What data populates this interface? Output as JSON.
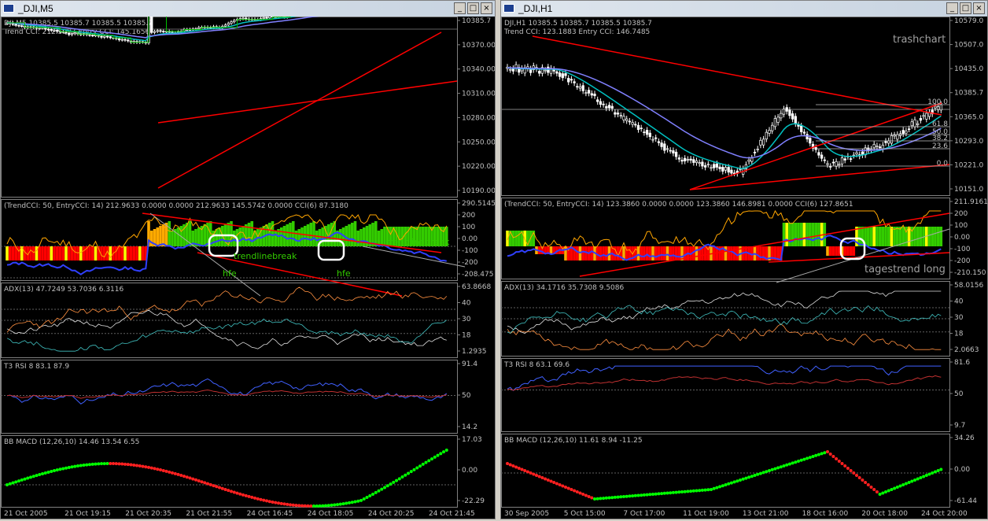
{
  "left_window": {
    "title": "_DJI,M5",
    "main_header_1": "DJI,M5  10385.5  10385.7  10385.5  10385.7",
    "main_header_2": "Trend CCI: 212.5097 Entry CCI: 145.1656",
    "price_ticks": [
      "10385.7",
      "10370.00",
      "10340.00",
      "10310.00",
      "10280.00",
      "10250.00",
      "10220.00",
      "10190.00"
    ],
    "cci_header": "(TrendCCI: 50, EntryCCI: 14)  212.9633  0.0000  0.0000  212.9633  145.5742  0.0000  CCI(6) 87.3180",
    "cci_ticks": [
      "290.5145",
      "200",
      "100",
      "0.00",
      "-100",
      "-200",
      "-208.475"
    ],
    "cci_notes": [
      "trendlinebreak",
      "trendlinebreak",
      "hfe",
      "hfe"
    ],
    "adx_header": "ADX(13) 47.7249 53.7036 6.3116",
    "adx_ticks": [
      "63.8668",
      "40",
      "30",
      "18",
      "1.2935"
    ],
    "rsi_header": "T3 RSI 8 83.1 87.9",
    "rsi_ticks": [
      "91.4",
      "50",
      "14.2"
    ],
    "macd_header": "BB MACD (12,26,10) 14.46 13.54 6.55",
    "macd_ticks": [
      "17.03",
      "0.00",
      "-22.29"
    ],
    "time_labels": [
      "21 Oct 2005",
      "21 Oct 19:15",
      "21 Oct 20:35",
      "21 Oct 21:55",
      "24 Oct 16:45",
      "24 Oct 18:05",
      "24 Oct 20:25",
      "24 Oct 21:45"
    ]
  },
  "right_window": {
    "title": "_DJI,H1",
    "main_header_1": "DJI,H1  10385.5  10385.7  10385.5  10385.7",
    "main_header_2": "Trend CCI: 123.1883 Entry CCI: 146.7485",
    "watermark": "trashchart",
    "price_ticks": [
      "10579.0",
      "10507.0",
      "10435.0",
      "10385.7",
      "10365.0",
      "10293.0",
      "10221.0",
      "10151.0"
    ],
    "fib_labels": [
      "100.0",
      "61.8",
      "50.0",
      "38.2",
      "23.6",
      "0.0"
    ],
    "cci_header": "(TrendCCI: 50, EntryCCI: 14)  123.3860  0.0000  0.0000  123.3860  146.8981  0.0000  CCI(6) 127.8651",
    "cci_ticks": [
      "211.9161",
      "200",
      "100",
      "0.00",
      "-100",
      "-200",
      "-210.150"
    ],
    "cci_note": "tagestrend long",
    "adx_header": "ADX(13) 34.1716 35.7308 9.5086",
    "adx_ticks": [
      "58.0156",
      "40",
      "30",
      "18",
      "2.0663"
    ],
    "rsi_header": "T3 RSI 8 63.1 69.6",
    "rsi_ticks": [
      "81.6",
      "50",
      "9.7"
    ],
    "macd_header": "BB MACD (12,26,10) 11.61 8.94 -11.25",
    "macd_ticks": [
      "34.26",
      "0.00",
      "-61.44"
    ],
    "time_labels": [
      "30 Sep 2005",
      "5 Oct 15:00",
      "7 Oct 17:00",
      "11 Oct 19:00",
      "13 Oct 21:00",
      "18 Oct 16:00",
      "20 Oct 18:00",
      "24 Oct 20:00"
    ]
  },
  "colors": {
    "bg": "#000000",
    "grid": "#404040",
    "up": "#00ff00",
    "down": "#ff0000",
    "trend": "#ff0000",
    "ma1": "#00c0c0",
    "ma2": "#8080ff",
    "text": "#c0c0c0"
  }
}
